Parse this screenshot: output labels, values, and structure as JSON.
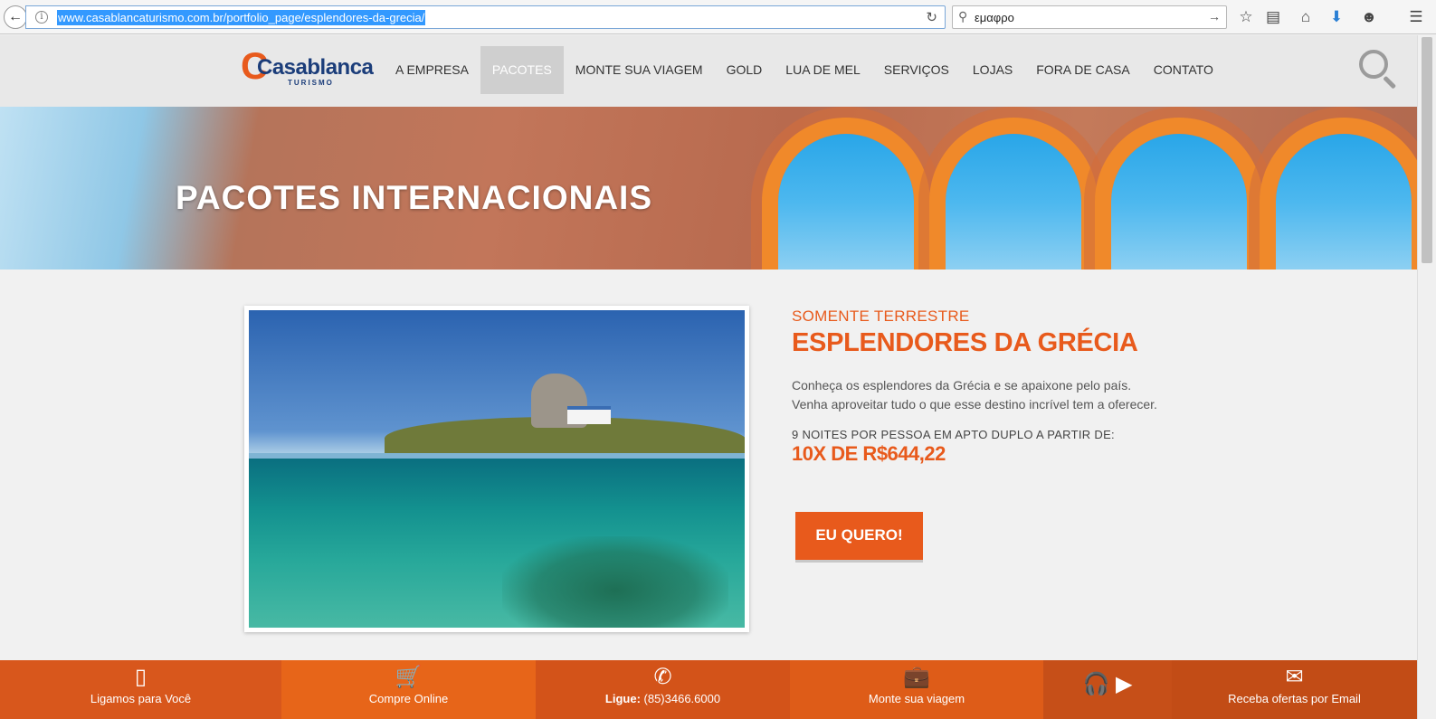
{
  "browser": {
    "url": "www.casablancaturismo.com.br/portfolio_page/esplendores-da-grecia/",
    "search_query": "εμαφρο",
    "icons": [
      "back-arrow-icon",
      "info-icon",
      "reload-icon",
      "search-icon",
      "go-arrow-icon",
      "bookmark-star-icon",
      "reading-list-icon",
      "home-icon",
      "download-icon",
      "chat-icon",
      "menu-icon"
    ]
  },
  "header": {
    "logo_main": "Casablanca",
    "logo_sub": "TURISMO",
    "nav": [
      "A EMPRESA",
      "PACOTES",
      "MONTE SUA VIAGEM",
      "GOLD",
      "LUA DE MEL",
      "SERVIÇOS",
      "LOJAS",
      "FORA DE CASA",
      "CONTATO"
    ],
    "active_nav": "PACOTES"
  },
  "banner": {
    "title": "PACOTES INTERNACIONAIS"
  },
  "package": {
    "kicker": "SOMENTE TERRESTRE",
    "title": "ESPLENDORES DA GRÉCIA",
    "description": "Conheça os esplendores da Grécia e se apaixone pelo país. Venha aproveitar tudo o que esse destino incrível tem a oferecer.",
    "price_label": "9 NOITES POR PESSOA EM APTO DUPLO A PARTIR DE:",
    "price": "10X DE R$644,22",
    "cta": "EU QUERO!"
  },
  "footer": {
    "items": [
      {
        "label": "Ligamos para Você",
        "icon": "mobile-phone-icon"
      },
      {
        "label": "Compre Online",
        "icon": "shopping-cart-icon"
      },
      {
        "label_bold": "Ligue:",
        "label": " (85)3466.6000",
        "icon": "phone-icon"
      },
      {
        "label": "Monte sua viagem",
        "icon": "suitcase-icon"
      },
      {
        "label": "",
        "icon": "headphones-play-icon"
      },
      {
        "label": "Receba ofertas por Email",
        "icon": "envelope-icon"
      }
    ]
  },
  "colors": {
    "brand_orange": "#e85a1c",
    "brand_blue": "#1b3d7a"
  }
}
